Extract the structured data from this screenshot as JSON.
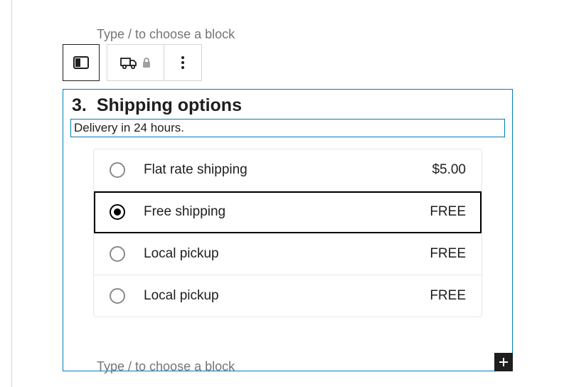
{
  "hints": {
    "slash_top": "Type / to choose a block",
    "slash_bottom": "Type / to choose a block"
  },
  "block": {
    "number": "3.",
    "title": "Shipping options",
    "description": "Delivery in 24 hours."
  },
  "options": [
    {
      "label": "Flat rate shipping",
      "price": "$5.00",
      "selected": false
    },
    {
      "label": "Free shipping",
      "price": "FREE",
      "selected": true
    },
    {
      "label": "Local pickup",
      "price": "FREE",
      "selected": false
    },
    {
      "label": "Local pickup",
      "price": "FREE",
      "selected": false
    }
  ]
}
